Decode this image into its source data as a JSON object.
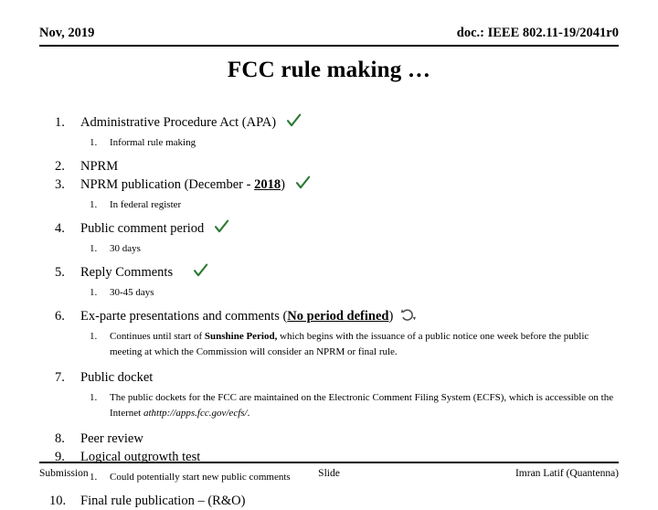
{
  "header": {
    "date": "Nov, 2019",
    "doc_id": "doc.: IEEE 802.11-19/2041r0"
  },
  "title": "FCC rule making …",
  "colors": {
    "check_green": "#2d7a33",
    "cycle_gray": "#4a4a4a",
    "text": "#000000",
    "background": "#ffffff"
  },
  "outline": {
    "item1": {
      "num": "1.",
      "text": "Administrative Procedure Act (APA)",
      "status": "check"
    },
    "item1_sub1": {
      "num": "1.",
      "text": "Informal rule making"
    },
    "item2": {
      "num": "2.",
      "text": "NPRM",
      "status": "none"
    },
    "item3": {
      "num": "3.",
      "text_before": "NPRM publication (December - ",
      "emphasis": "2018",
      "text_after": ")",
      "status": "check"
    },
    "item3_sub1": {
      "num": "1.",
      "text": "In federal register"
    },
    "item4": {
      "num": "4.",
      "text": "Public comment period",
      "status": "check"
    },
    "item4_sub1": {
      "num": "1.",
      "text": "30 days"
    },
    "item5": {
      "num": "5.",
      "text": "Reply Comments",
      "status": "check"
    },
    "item5_sub1": {
      "num": "1.",
      "text": "30-45 days"
    },
    "item6": {
      "num": "6.",
      "text_before": "Ex-parte presentations and comments (",
      "emphasis": "No period defined",
      "text_after": ")",
      "status": "cycle"
    },
    "item6_sub1": {
      "num": "1.",
      "text_before": "Continues until start of ",
      "emphasis": "Sunshine Period,",
      "text_after": " which begins with the issuance of a public notice one week before the public meeting at which the Commission will consider an NPRM or final rule."
    },
    "item7": {
      "num": "7.",
      "text": "Public docket",
      "status": "none"
    },
    "item7_sub1": {
      "num": "1.",
      "text_before": "The public dockets for the FCC are maintained on the Electronic Comment Filing System (ECFS), which is accessible on the Internet ",
      "emphasis": "athttp://apps.fcc.gov/ecfs/",
      "text_after": "."
    },
    "item8": {
      "num": "8.",
      "text": "Peer review",
      "status": "none"
    },
    "item9": {
      "num": "9.",
      "text": "Logical outgrowth test",
      "status": "none"
    },
    "item9_sub1": {
      "num": "1.",
      "text": "Could potentially start new public comments"
    },
    "item10": {
      "num": "10.",
      "text": "Final rule publication – (R&O)",
      "status": "none"
    }
  },
  "footer": {
    "left": "Submission",
    "center": "Slide",
    "right": "Imran Latif (Quantenna)"
  }
}
